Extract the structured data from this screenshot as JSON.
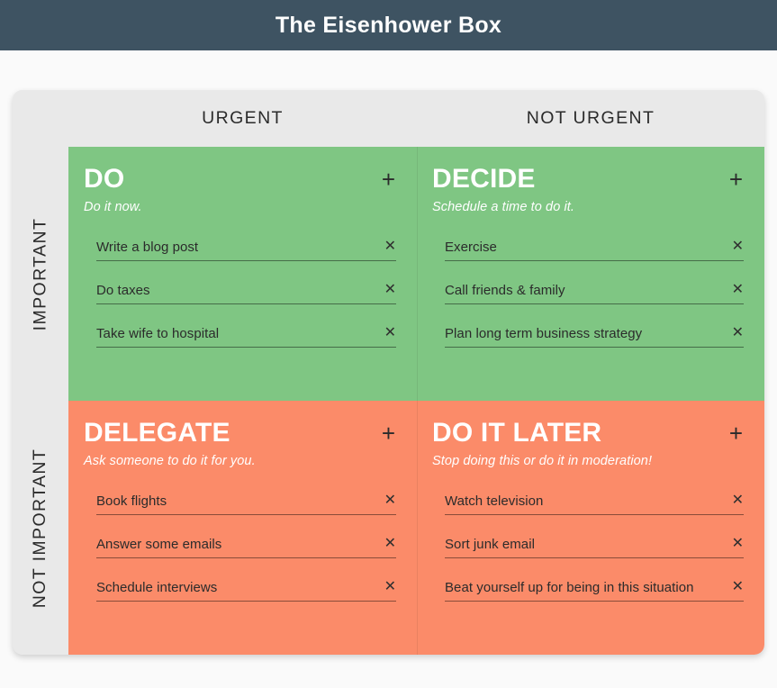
{
  "titlebar": {
    "title": "The Eisenhower Box"
  },
  "matrix": {
    "column_headers": [
      "URGENT",
      "NOT URGENT"
    ],
    "row_headers": [
      "IMPORTANT",
      "NOT IMPORTANT"
    ],
    "add_icon": "+",
    "delete_icon": "✕",
    "colors": {
      "titlebar_bg": "#3E5362",
      "page_bg": "#FAFAFA",
      "card_bg": "#E9E9E9",
      "important_quadrant": "#7FC683",
      "not_important_quadrant": "#FB8B69",
      "heading_text": "#FFFFFF",
      "task_text": "#2B2B2B"
    },
    "quadrants": [
      {
        "key": "do",
        "title": "DO",
        "subtitle": "Do it now.",
        "tasks": [
          "Write a blog post",
          "Do taxes",
          "Take wife to hospital"
        ]
      },
      {
        "key": "decide",
        "title": "DECIDE",
        "subtitle": "Schedule a time to do it.",
        "tasks": [
          "Exercise",
          "Call friends & family",
          "Plan long term business strategy"
        ]
      },
      {
        "key": "delegate",
        "title": "DELEGATE",
        "subtitle": "Ask someone to do it for you.",
        "tasks": [
          "Book flights",
          "Answer some emails",
          "Schedule interviews"
        ]
      },
      {
        "key": "do-it-later",
        "title": "DO IT LATER",
        "subtitle": "Stop doing this or do it in moderation!",
        "tasks": [
          "Watch television",
          "Sort junk email",
          "Beat yourself up for being in this situation"
        ]
      }
    ]
  }
}
